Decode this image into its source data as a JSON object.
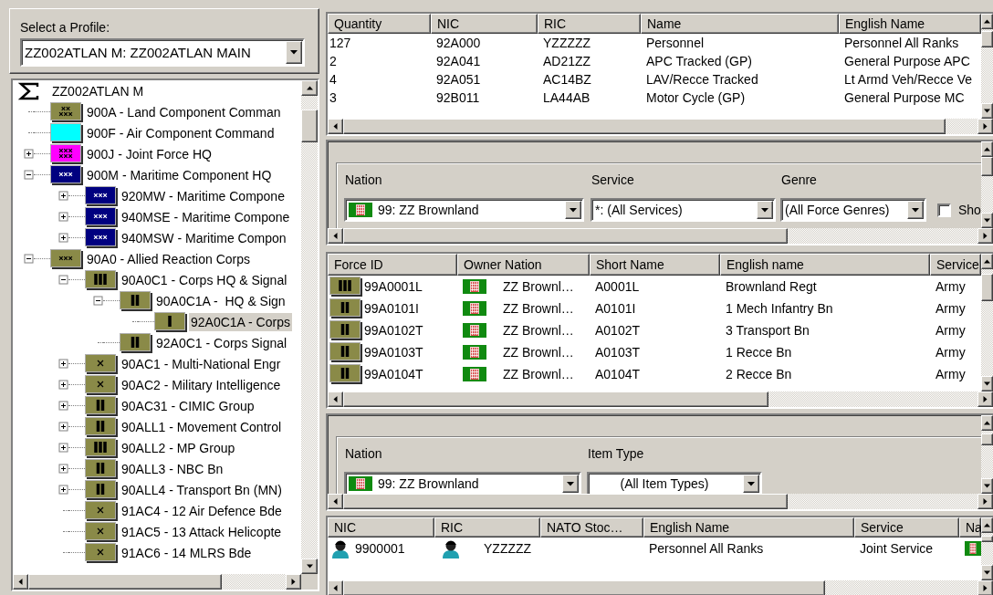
{
  "profile": {
    "label": "Select a Profile:",
    "value": "ZZ002ATLAN M: ZZ002ATLAN MAIN"
  },
  "tree": {
    "root": {
      "label": "ZZ002ATLAN M",
      "selected": false,
      "children": [
        {
          "label": "900A - Land Component Comman",
          "kind": "army-group",
          "color": "#8a8a48",
          "selected": false
        },
        {
          "label": "900F - Air Component Command",
          "color": "#00ffff",
          "selected": false
        },
        {
          "label": "900J - Joint Force HQ",
          "kind": "theater",
          "color": "#ff00ff",
          "selected": false,
          "expanded": false
        },
        {
          "label": "900M - Maritime Component HQ",
          "kind": "corps",
          "color": "#000080",
          "selected": false,
          "expanded": true,
          "children": [
            {
              "label": "920MW - Maritime Compone",
              "kind": "corps",
              "color": "#000080",
              "selected": false,
              "expanded": false
            },
            {
              "label": "940MSE - Maritime Compone",
              "kind": "corps",
              "color": "#000080",
              "selected": false,
              "expanded": false
            },
            {
              "label": "940MSW - Maritime Compon",
              "kind": "corps",
              "color": "#000080",
              "selected": false,
              "expanded": false
            }
          ]
        },
        {
          "label": "90A0 - Allied Reaction Corps",
          "kind": "corps",
          "color": "#8a8a48",
          "selected": false,
          "expanded": true,
          "children": [
            {
              "label": "90A0C1 - Corps HQ & Signal",
              "kind": "regiment",
              "color": "#8a8a48",
              "selected": false,
              "expanded": true,
              "children": [
                {
                  "label": "90A0C1A -  HQ & Sign",
                  "kind": "battalion",
                  "color": "#8a8a48",
                  "selected": false,
                  "expanded": true,
                  "children": [
                    {
                      "label": "92A0C1A - Corps",
                      "kind": "company",
                      "color": "#8a8a48",
                      "selected": true
                    }
                  ]
                },
                {
                  "label": "92A0C1 - Corps Signal",
                  "kind": "battalion",
                  "color": "#8a8a48",
                  "selected": false
                }
              ]
            },
            {
              "label": "90AC1 - Multi-National Engr",
              "kind": "brigade",
              "color": "#8a8a48",
              "selected": false,
              "expanded": false
            },
            {
              "label": "90AC2 - Military Intelligence",
              "kind": "brigade",
              "color": "#8a8a48",
              "selected": false,
              "expanded": false
            },
            {
              "label": "90AC31 - CIMIC Group",
              "kind": "battalion",
              "color": "#8a8a48",
              "selected": false,
              "expanded": false
            },
            {
              "label": "90ALL1 - Movement Control",
              "kind": "battalion",
              "color": "#8a8a48",
              "selected": false,
              "expanded": false
            },
            {
              "label": "90ALL2 - MP Group",
              "kind": "regiment",
              "color": "#8a8a48",
              "selected": false,
              "expanded": false
            },
            {
              "label": "90ALL3 - NBC Bn",
              "kind": "battalion",
              "color": "#8a8a48",
              "selected": false,
              "expanded": false
            },
            {
              "label": "90ALL4 - Transport Bn (MN)",
              "kind": "battalion",
              "color": "#8a8a48",
              "selected": false,
              "expanded": false
            },
            {
              "label": "91AC4 - 12 Air Defence Bde",
              "kind": "brigade",
              "color": "#8a8a48",
              "selected": false
            },
            {
              "label": "91AC5 - 13 Attack Helicopte",
              "kind": "brigade",
              "color": "#8a8a48",
              "selected": false
            },
            {
              "label": "91AC6 - 14 MLRS Bde",
              "kind": "brigade",
              "color": "#8a8a48",
              "selected": false
            }
          ]
        }
      ]
    }
  },
  "equipment_table": {
    "columns": [
      "Quantity",
      "NIC",
      "RIC",
      "Name",
      "English Name"
    ],
    "rows": [
      [
        "127",
        "92A000",
        "YZZZZZ",
        "Personnel",
        "Personnel All Ranks"
      ],
      [
        "2",
        "92A041",
        "AD21ZZ",
        "APC Tracked (GP)",
        "General Purpose APC"
      ],
      [
        "4",
        "92A051",
        "AC14BZ",
        "LAV/Recce Tracked",
        "Lt Armd Veh/Recce Ve"
      ],
      [
        "3",
        "92B011",
        "LA44AB",
        "Motor Cycle (GP)",
        "General Purpose MC"
      ]
    ]
  },
  "force_filter": {
    "fields": [
      {
        "kind": "flag-combo",
        "label": "Nation",
        "value": "99: ZZ Brownland"
      },
      {
        "kind": "combo",
        "label": "Service",
        "value": "*: (All Services)"
      },
      {
        "kind": "combo",
        "label": "Genre",
        "value": "(All Force Genres)"
      },
      {
        "kind": "checkbox",
        "label": "Sho",
        "checked": false
      }
    ]
  },
  "forces_table": {
    "columns": [
      "Force ID",
      "Owner Nation",
      "Short Name",
      "English name",
      "Service"
    ],
    "rows": [
      {
        "kind": "regiment",
        "cells": [
          "99A0001L",
          "ZZ Brownl…",
          "A0001L",
          "Brownland Regt",
          "Army"
        ]
      },
      {
        "kind": "battalion",
        "cells": [
          "99A0101I",
          "ZZ Brownl…",
          "A0101I",
          "1 Mech Infantry Bn",
          "Army"
        ]
      },
      {
        "kind": "battalion",
        "cells": [
          "99A0102T",
          "ZZ Brownl…",
          "A0102T",
          "3 Transport Bn",
          "Army"
        ]
      },
      {
        "kind": "battalion",
        "cells": [
          "99A0103T",
          "ZZ Brownl…",
          "A0103T",
          "1 Recce Bn",
          "Army"
        ]
      },
      {
        "kind": "battalion",
        "cells": [
          "99A0104T",
          "ZZ Brownl…",
          "A0104T",
          "2 Recce Bn",
          "Army"
        ]
      }
    ]
  },
  "item_filter": {
    "fields": [
      {
        "kind": "flag-combo",
        "label": "Nation",
        "value": "99: ZZ Brownland"
      },
      {
        "kind": "combo",
        "label": "Item Type",
        "value": "(All Item Types)"
      }
    ]
  },
  "items_table": {
    "columns": [
      "NIC",
      "RIC",
      "NATO Stoc…",
      "English Name",
      "Service",
      "Na"
    ],
    "rows": [
      {
        "kind": "personnel",
        "nic": "9900001",
        "ric": "YZZZZZ",
        "english_name": "Personnel All Ranks",
        "service": "Joint Service"
      }
    ]
  }
}
